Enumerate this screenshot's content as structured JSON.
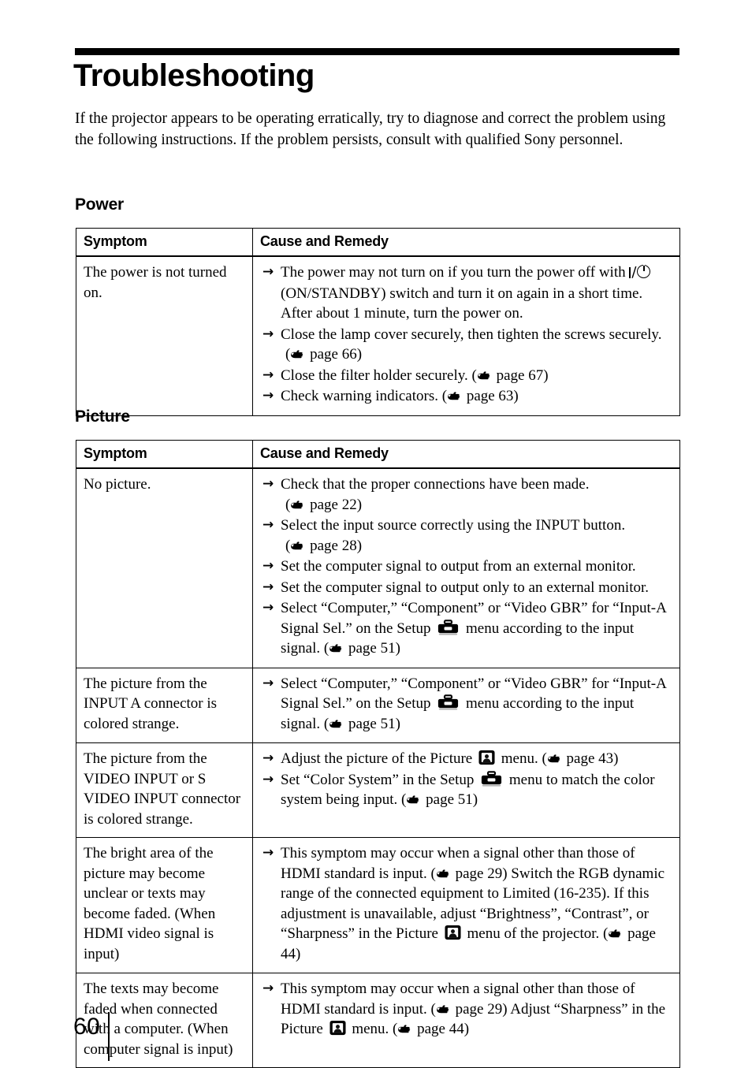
{
  "page": {
    "title": "Troubleshooting",
    "intro": "If the projector appears to be operating erratically, try to diagnose and correct the problem using the following instructions. If the problem persists, consult with qualified Sony personnel.",
    "folio": "60"
  },
  "table_headers": {
    "symptom": "Symptom",
    "cause_and_remedy": "Cause and Remedy"
  },
  "icons": {
    "reference_mark": "pointing-hand-icon",
    "setup_menu": "toolbox-icon",
    "picture_menu": "picture-menu-icon",
    "on_standby": "power-on-standby-icon",
    "bullet": "arrow-right-icon"
  },
  "sections": [
    {
      "heading": "Power",
      "rows": [
        {
          "symptom": "The power is not turned on.",
          "remedies": [
            {
              "part1": "The power may not turn on if you turn the power off with ",
              "has_power_icon": true,
              "part2": " (ON/STANDBY) switch and turn it on again in a short time. After about 1 minute, turn the power on."
            },
            {
              "part1": "Close the lamp cover securely, then tighten the screws securely.",
              "ref_prefix": "(",
              "ref_text": " page 66)",
              "ref_on_new_line": true
            },
            {
              "part1": "Close the filter holder securely. (",
              "ref_inline": true,
              "ref_text": " page 67)"
            },
            {
              "part1": "Check warning indicators. (",
              "ref_inline": true,
              "ref_text": " page 63)"
            }
          ]
        }
      ]
    },
    {
      "heading": "Picture",
      "rows": [
        {
          "symptom": "No picture.",
          "remedies": [
            {
              "part1": "Check that the proper connections have been made.",
              "ref_prefix": "(",
              "ref_text": " page 22)",
              "ref_on_new_line": true
            },
            {
              "part1": "Select the input source correctly using the INPUT button.",
              "ref_prefix": "(",
              "ref_text": " page 28)",
              "ref_on_new_line": true
            },
            {
              "part1": "Set the computer signal to output from an external monitor."
            },
            {
              "part1": "Set the computer signal to output only to an external monitor."
            },
            {
              "part1": "Select “Computer,” “Component” or “Video GBR” for “Input-A Signal Sel.” on the Setup ",
              "has_toolbox_icon": true,
              "part2": " menu according to the input signal. (",
              "ref_inline_tail": true,
              "ref_text": " page 51)"
            }
          ]
        },
        {
          "symptom": "The picture from the INPUT A connector is colored strange.",
          "remedies": [
            {
              "part1": "Select “Computer,” “Component” or “Video GBR” for “Input-A Signal Sel.” on the Setup ",
              "has_toolbox_icon": true,
              "part2": " menu according to the input signal. (",
              "ref_inline_tail": true,
              "ref_text": " page 51)"
            }
          ]
        },
        {
          "symptom": "The picture from the VIDEO INPUT or S VIDEO INPUT connector is colored strange.",
          "remedies": [
            {
              "part1": "Adjust the picture of the Picture ",
              "has_picture_icon": true,
              "part2": " menu. (",
              "ref_inline_tail": true,
              "ref_text": " page 43)"
            },
            {
              "part1": "Set “Color System” in the Setup ",
              "has_toolbox_icon": true,
              "part2": " menu to match the color system being input. (",
              "ref_inline_tail": true,
              "ref_text": " page 51)"
            }
          ]
        },
        {
          "symptom": "The bright area of the picture may become unclear or texts may become faded. (When HDMI video signal is input)",
          "remedies": [
            {
              "part1": "This symptom may occur when a signal other than those of HDMI standard is input. (",
              "ref_inline_mid": true,
              "ref_text": " page 29)",
              "part2": " Switch the RGB dynamic range of the connected equipment to Limited (16-235). If this adjustment is unavailable, adjust “Brightness”, “Contrast”, or “Sharpness” in the Picture ",
              "has_picture_icon": true,
              "part3": " menu of the projector. (",
              "ref_inline_tail": true,
              "ref_text2": " page 44)"
            }
          ]
        },
        {
          "symptom": "The texts may become faded when connected with a computer. (When computer signal is input)",
          "remedies": [
            {
              "part1": "This symptom may occur when a signal other than those of HDMI standard is input. (",
              "ref_inline_mid": true,
              "ref_text": " page 29)",
              "part2": " Adjust “Sharpness” in the Picture ",
              "has_picture_icon": true,
              "part3": " menu. (",
              "ref_inline_tail": true,
              "ref_text2": " page 44)"
            }
          ]
        }
      ]
    }
  ]
}
